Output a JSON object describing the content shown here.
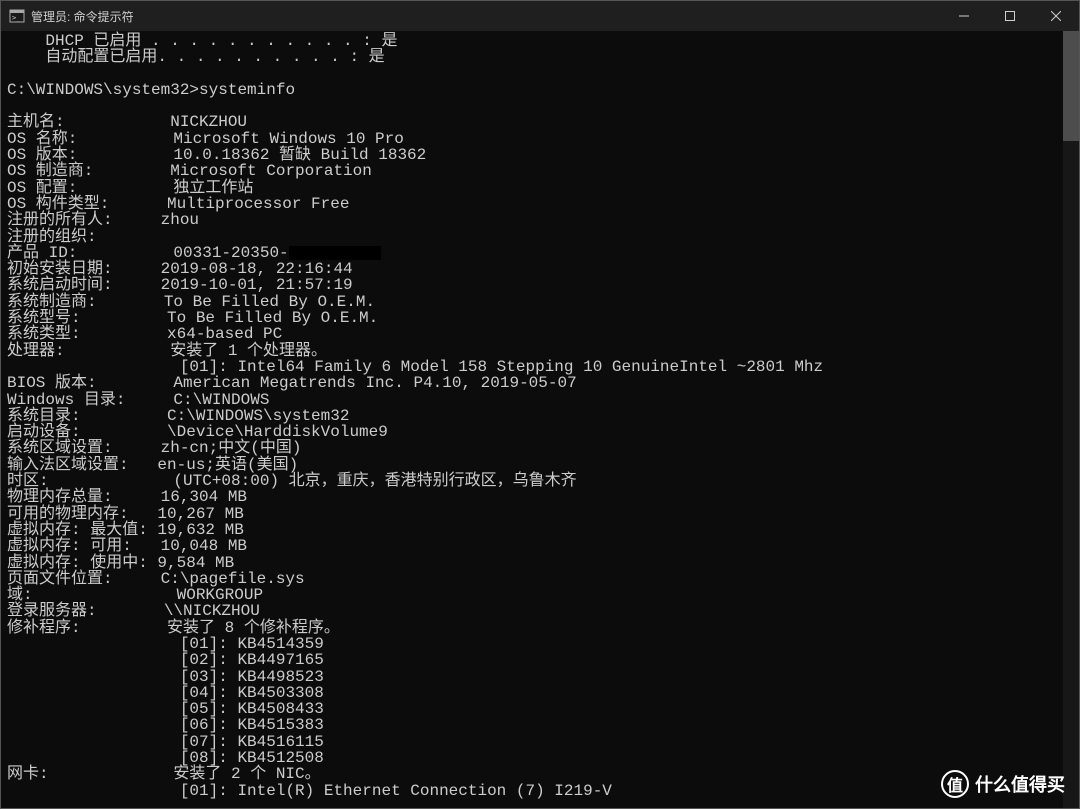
{
  "titlebar": {
    "title": "管理员: 命令提示符"
  },
  "preamble": {
    "dhcp_line": "    DHCP 已启用 . . . . . . . . . . . : 是",
    "autoconf_line": "    自动配置已启用. . . . . . . . . . : 是"
  },
  "prompt": {
    "path": "C:\\WINDOWS\\system32>",
    "command": "systeminfo"
  },
  "sysinfo_rows": [
    {
      "label": "主机名:",
      "value": "NICKZHOU"
    },
    {
      "label": "OS 名称:",
      "value": "Microsoft Windows 10 Pro"
    },
    {
      "label": "OS 版本:",
      "value": "10.0.18362 暂缺 Build 18362"
    },
    {
      "label": "OS 制造商:",
      "value": "Microsoft Corporation"
    },
    {
      "label": "OS 配置:",
      "value": "独立工作站"
    },
    {
      "label": "OS 构件类型:",
      "value": "Multiprocessor Free"
    },
    {
      "label": "注册的所有人:",
      "value": "zhou"
    },
    {
      "label": "注册的组织:",
      "value": ""
    },
    {
      "label": "产品 ID:",
      "value": "00331-20350-",
      "redacted_tail": true
    },
    {
      "label": "初始安装日期:",
      "value": "2019-08-18, 22:16:44"
    },
    {
      "label": "系统启动时间:",
      "value": "2019-10-01, 21:57:19"
    },
    {
      "label": "系统制造商:",
      "value": "To Be Filled By O.E.M."
    },
    {
      "label": "系统型号:",
      "value": "To Be Filled By O.E.M."
    },
    {
      "label": "系统类型:",
      "value": "x64-based PC"
    },
    {
      "label": "处理器:",
      "value": "安装了 1 个处理器。"
    },
    {
      "indent": true,
      "value": "[01]: Intel64 Family 6 Model 158 Stepping 10 GenuineIntel ~2801 Mhz"
    },
    {
      "label": "BIOS 版本:",
      "value": "American Megatrends Inc. P4.10, 2019-05-07"
    },
    {
      "label": "Windows 目录:",
      "value": "C:\\WINDOWS"
    },
    {
      "label": "系统目录:",
      "value": "C:\\WINDOWS\\system32"
    },
    {
      "label": "启动设备:",
      "value": "\\Device\\HarddiskVolume9"
    },
    {
      "label": "系统区域设置:",
      "value": "zh-cn;中文(中国)"
    },
    {
      "label": "输入法区域设置:",
      "value": "en-us;英语(美国)"
    },
    {
      "label": "时区:",
      "value": "(UTC+08:00) 北京，重庆，香港特别行政区，乌鲁木齐"
    },
    {
      "label": "物理内存总量:",
      "value": "16,304 MB"
    },
    {
      "label": "可用的物理内存:",
      "value": "10,267 MB"
    },
    {
      "label": "虚拟内存: 最大值:",
      "value": "19,632 MB"
    },
    {
      "label": "虚拟内存: 可用:",
      "value": "10,048 MB"
    },
    {
      "label": "虚拟内存: 使用中:",
      "value": "9,584 MB"
    },
    {
      "label": "页面文件位置:",
      "value": "C:\\pagefile.sys"
    },
    {
      "label": "域:",
      "value": "WORKGROUP"
    },
    {
      "label": "登录服务器:",
      "value": "\\\\NICKZHOU"
    },
    {
      "label": "修补程序:",
      "value": "安装了 8 个修补程序。"
    },
    {
      "indent": true,
      "value": "[01]: KB4514359"
    },
    {
      "indent": true,
      "value": "[02]: KB4497165"
    },
    {
      "indent": true,
      "value": "[03]: KB4498523"
    },
    {
      "indent": true,
      "value": "[04]: KB4503308"
    },
    {
      "indent": true,
      "value": "[05]: KB4508433"
    },
    {
      "indent": true,
      "value": "[06]: KB4515383"
    },
    {
      "indent": true,
      "value": "[07]: KB4516115"
    },
    {
      "indent": true,
      "value": "[08]: KB4512508"
    },
    {
      "label": "网卡:",
      "value": "安装了 2 个 NIC。"
    },
    {
      "indent": true,
      "value": "[01]: Intel(R) Ethernet Connection (7) I219-V"
    }
  ],
  "layout": {
    "label_display_width": 18
  },
  "watermark": {
    "badge": "值",
    "text": "什么值得买"
  }
}
